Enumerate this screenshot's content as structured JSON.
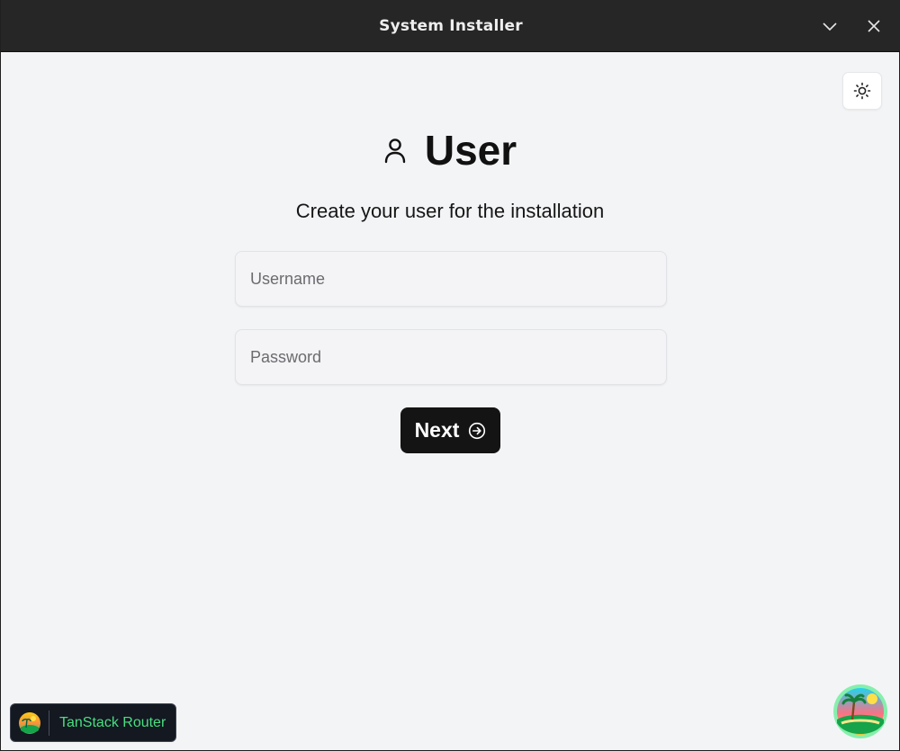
{
  "window": {
    "title": "System Installer"
  },
  "page": {
    "heading": "User",
    "subtitle": "Create your user for the installation"
  },
  "form": {
    "username_placeholder": "Username",
    "username_value": "",
    "password_placeholder": "Password",
    "password_value": ""
  },
  "actions": {
    "next_label": "Next"
  },
  "devtools": {
    "router_label": "TanStack Router"
  },
  "icons": {
    "minimize": "chevron-down-icon",
    "close": "close-icon",
    "theme": "sun-icon",
    "heading": "user-icon",
    "next": "arrow-right-circle-icon"
  },
  "colors": {
    "titlebar": "#262626",
    "background": "#f3f4f6",
    "primary_button": "#141414",
    "router_label": "#4ade80"
  }
}
